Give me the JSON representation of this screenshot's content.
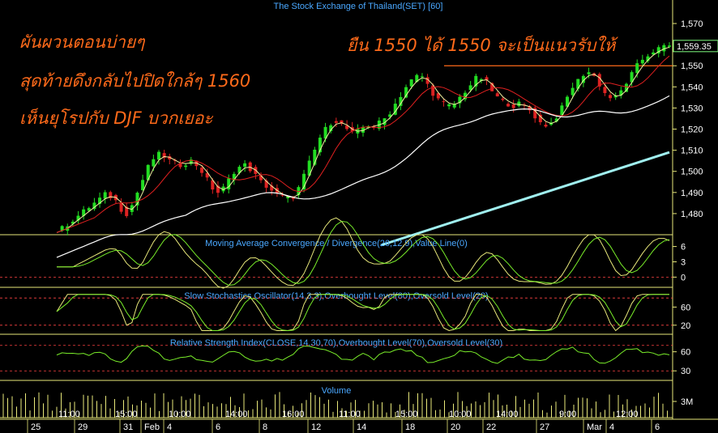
{
  "colors": {
    "background": "#000000",
    "annotation": "#ff6a1a",
    "title": "#4aa8ff",
    "panel_border": "#e8e87a",
    "candle_up": "#22dd22",
    "candle_down": "#dd2222",
    "ma_fast": "#f0f0a0",
    "ma_mid": "#e02020",
    "ma_slow": "#ffffff",
    "ma_long": "#a0f0f0",
    "signal_line": "#e8e87a",
    "indicator_line": "#7aee2a",
    "level_line": "#ff4444",
    "resistance": "#ff6a1a",
    "price_box": "#7fff7f"
  },
  "annotations": {
    "left_line1": "ผันผวนตอนบ่ายๆ",
    "left_line2": "สุดท้ายดึงกลับไปปิดใกล้ๆ 1560",
    "left_line3": "เห็นยุโรปกับ DJF บวกเยอะ",
    "right_line1": "ยืน 1550 ได้ 1550 จะเป็นแนวรับให้"
  },
  "chart_data": [
    {
      "type": "candlestick",
      "title": "The Stock Exchange of Thailand(SET) [60]",
      "y_ticks": [
        "1,570",
        "1,560",
        "1,550",
        "1,540",
        "1,530",
        "1,520",
        "1,510",
        "1,500",
        "1,490",
        "1,480"
      ],
      "y_tick_values": [
        1570,
        1560,
        1550,
        1540,
        1530,
        1520,
        1510,
        1500,
        1490,
        1480
      ],
      "ylim": [
        1470,
        1575
      ],
      "last_price_label": "1,559.35",
      "resistance_level": 1550,
      "close_series": [
        1471,
        1473,
        1475,
        1477,
        1479,
        1481,
        1483,
        1485,
        1487,
        1489,
        1488,
        1486,
        1482,
        1480,
        1484,
        1490,
        1496,
        1502,
        1506,
        1508,
        1507,
        1505,
        1504,
        1503,
        1504,
        1505,
        1503,
        1500,
        1496,
        1492,
        1490,
        1492,
        1496,
        1500,
        1502,
        1503,
        1501,
        1498,
        1495,
        1493,
        1491,
        1489,
        1488,
        1487,
        1488,
        1492,
        1498,
        1504,
        1510,
        1516,
        1520,
        1523,
        1524,
        1522,
        1520,
        1518,
        1519,
        1521,
        1522,
        1521,
        1523,
        1525,
        1528,
        1532,
        1536,
        1540,
        1543,
        1545,
        1545,
        1541,
        1537,
        1534,
        1532,
        1531,
        1532,
        1535,
        1538,
        1541,
        1544,
        1544,
        1542,
        1538,
        1535,
        1533,
        1532,
        1531,
        1532,
        1531,
        1529,
        1526,
        1523,
        1522,
        1523,
        1526,
        1530,
        1535,
        1540,
        1543,
        1546,
        1547,
        1545,
        1541,
        1537,
        1535,
        1535,
        1538,
        1542,
        1546,
        1550,
        1553,
        1555,
        1557,
        1558,
        1559,
        1559.35
      ],
      "ma_long_series": [
        [
          1465,
          1420
        ],
        [
          1470,
          1430
        ],
        [
          1478,
          1440
        ],
        [
          1485,
          1450
        ],
        [
          1490,
          1460
        ],
        [
          1495,
          1470
        ],
        [
          1500,
          1478
        ],
        [
          1504,
          1488
        ],
        [
          1507,
          1498
        ],
        [
          1509,
          1508
        ]
      ]
    },
    {
      "type": "line",
      "title": "Moving Average Convergence / Divergence(26,12,9),Value Line(0)",
      "y_ticks": [
        "6",
        "3",
        "0"
      ],
      "y_tick_values": [
        6,
        3,
        0
      ],
      "ylim": [
        -2,
        8
      ],
      "zero_level": 0
    },
    {
      "type": "line",
      "title": "Slow Stochastics Oscillator(14,3,3),Overbought Level(80),Oversold Level(20)",
      "y_ticks": [
        "60",
        "20"
      ],
      "y_tick_values": [
        60,
        20
      ],
      "ylim": [
        0,
        100
      ],
      "levels": [
        80,
        20
      ]
    },
    {
      "type": "line",
      "title": "Relative Strength Index(CLOSE,14,30,70),Overbought Level(70),Oversold Level(30)",
      "y_ticks": [
        "60",
        "30"
      ],
      "y_tick_values": [
        60,
        30
      ],
      "ylim": [
        15,
        85
      ],
      "levels": [
        70,
        30
      ]
    },
    {
      "type": "bar",
      "title": "Volume",
      "y_ticks": [
        "3M"
      ],
      "y_tick_values": [
        3
      ]
    }
  ],
  "x_axis": {
    "row1": [
      "11:00",
      "15:00",
      "10:00",
      "14:00",
      "16:00",
      "11:00",
      "15:00",
      "10:00",
      "14:00",
      "9:00",
      "12:00"
    ],
    "row2": [
      "25",
      "29",
      "31",
      "Feb",
      "4",
      "6",
      "8",
      "12",
      "14",
      "18",
      "20",
      "22",
      "27",
      "Mar",
      "4",
      "6"
    ]
  }
}
